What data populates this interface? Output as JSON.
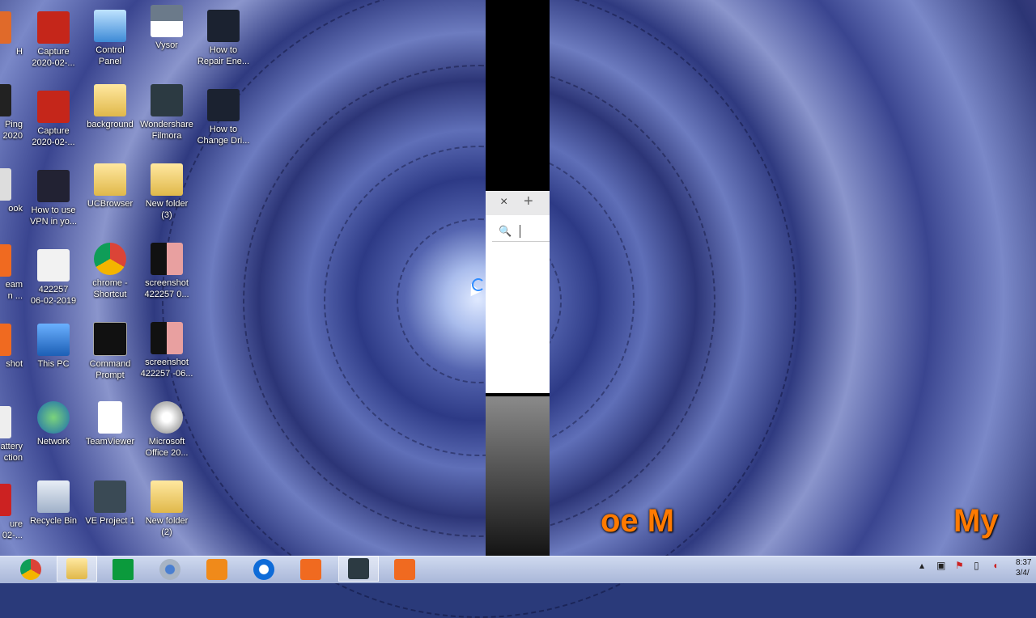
{
  "desktop": {
    "icons": [
      {
        "label": "H",
        "icon": "app-icon"
      },
      {
        "label": "Ping\n2020",
        "icon": "app-icon"
      },
      {
        "label": "ook",
        "icon": "app-icon"
      },
      {
        "label": "eam\nn ...",
        "icon": "app-icon"
      },
      {
        "label": "shot",
        "icon": "app-icon"
      },
      {
        "label": "attery\nction",
        "icon": "app-icon"
      },
      {
        "label": "ure\n02-...",
        "icon": "app-icon"
      },
      {
        "label": "Capture\n2020-02-...",
        "icon": "image-icon"
      },
      {
        "label": "Capture\n2020-02-...",
        "icon": "image-icon"
      },
      {
        "label": "How to use\nVPN in yo...",
        "icon": "video-icon"
      },
      {
        "label": "422257\n06-02-2019",
        "icon": "image-icon"
      },
      {
        "label": "This PC",
        "icon": "computer-icon"
      },
      {
        "label": "Network",
        "icon": "network-icon"
      },
      {
        "label": "Recycle Bin",
        "icon": "recycle-bin-icon"
      },
      {
        "label": "Control\nPanel",
        "icon": "control-panel-icon"
      },
      {
        "label": "background",
        "icon": "folder-icon"
      },
      {
        "label": "UCBrowser",
        "icon": "folder-icon"
      },
      {
        "label": "chrome -\nShortcut",
        "icon": "chrome-icon"
      },
      {
        "label": "Command\nPrompt",
        "icon": "cmd-icon"
      },
      {
        "label": "TeamViewer",
        "icon": "document-icon"
      },
      {
        "label": "VE Project 1",
        "icon": "filmora-project-icon"
      },
      {
        "label": "Vysor",
        "icon": "vysor-icon"
      },
      {
        "label": "Wondershare\nFilmora",
        "icon": "filmora-icon"
      },
      {
        "label": "New folder\n(3)",
        "icon": "folder-icon"
      },
      {
        "label": "screenshot\n422257 0...",
        "icon": "image-icon"
      },
      {
        "label": "screenshot\n422257 -06...",
        "icon": "image-icon"
      },
      {
        "label": "Microsoft\nOffice 20...",
        "icon": "disc-icon"
      },
      {
        "label": "New folder\n(2)",
        "icon": "folder-icon"
      },
      {
        "label": "How to\nRepair Ene...",
        "icon": "video-icon"
      },
      {
        "label": "How to\nChange Dri...",
        "icon": "video-icon"
      }
    ]
  },
  "popup": {
    "close": "×",
    "new_tab": "+",
    "search_icon": "🔍"
  },
  "overlay": {
    "left_text": "oe M",
    "right_text": "My"
  },
  "taskbar": {
    "apps": [
      "chrome",
      "file-explorer",
      "windows-store",
      "chrome-canary",
      "uc-browser",
      "teamviewer",
      "screenshot-tool",
      "filmora",
      "camera-app"
    ],
    "clock_time": "8:37",
    "clock_date": "3/4/"
  },
  "colors": {
    "overlay_text": "#ff7a00",
    "taskbar": "#b8c4e2"
  }
}
